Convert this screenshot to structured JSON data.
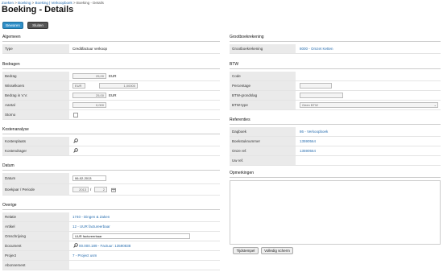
{
  "breadcrumb": [
    "Zoeken",
    "Boeking",
    "Boeking | Verkoopboek",
    "Boeking - Details"
  ],
  "page_title": "Boeking - Details",
  "toolbar": {
    "save_label": "Bewaren",
    "close_label": "Sluiten"
  },
  "algemeen": {
    "title": "Algemeen",
    "type_label": "Type",
    "type_value": "Creditfactuur verkoop"
  },
  "bedragen": {
    "title": "Bedragen",
    "bedrag_label": "Bedrag",
    "bedrag_value": "25,00",
    "bedrag_cur": "EUR",
    "wisselkoers_label": "Wisselkoers",
    "wisselkoers_cur": "EUR",
    "wisselkoers_value": "1,00000",
    "bedrag_vv_label": "Bedrag in V.V.",
    "bedrag_vv_value": "25,00",
    "bedrag_vv_cur": "EUR",
    "aantal_label": "Aantal",
    "aantal_value": "0,000",
    "storno_label": "Storno"
  },
  "kostenanalyse": {
    "title": "Kostenanalyse",
    "kostenplaats_label": "Kostenplaats",
    "kostendrager_label": "Kostendrager"
  },
  "datum": {
    "title": "Datum",
    "datum_label": "Datum",
    "datum_value": "06-02-2013",
    "boekjaar_label": "Boekjaar / Periode",
    "boekjaar_value": "2013",
    "periode_sep": "/",
    "periode_value": "2"
  },
  "overige": {
    "title": "Overige",
    "relatie_label": "Relatie",
    "relatie_value": "1740 - Dingen & Zaken",
    "artikel_label": "Artikel",
    "artikel_value": "12 - UUR factureerbaar",
    "omschrijving_label": "Omschrijving",
    "omschrijving_value": "UUR factureerbaar",
    "document_label": "Document",
    "document_value": "00.000.189 - Factuur: 13590838",
    "project_label": "Project",
    "project_value": "7 - Project usm",
    "abonnement_label": "Abonnement"
  },
  "grootboek": {
    "title": "Grootboekrekening",
    "label": "Grootboekrekening",
    "value": "8000 - Omzet Ketten"
  },
  "btw": {
    "title": "BTW",
    "code_label": "Code",
    "percentage_label": "Percentage",
    "grondslag_label": "BTW-grondslag",
    "type_label": "BTW-type",
    "type_value": "Geen BTW"
  },
  "referenties": {
    "title": "Referenties",
    "dagboek_label": "Dagboek",
    "dagboek_value": "86 - Verkoopboek",
    "boekstuk_label": "Boekstuknummer",
    "boekstuk_value": "13590564",
    "onze_ref_label": "Onze ref.",
    "onze_ref_value": "13590564",
    "uw_ref_label": "Uw ref."
  },
  "opmerkingen": {
    "title": "Opmerkingen",
    "timestamp_button": "Tijdstempel",
    "fullscreen_button": "Volledig scherm"
  }
}
